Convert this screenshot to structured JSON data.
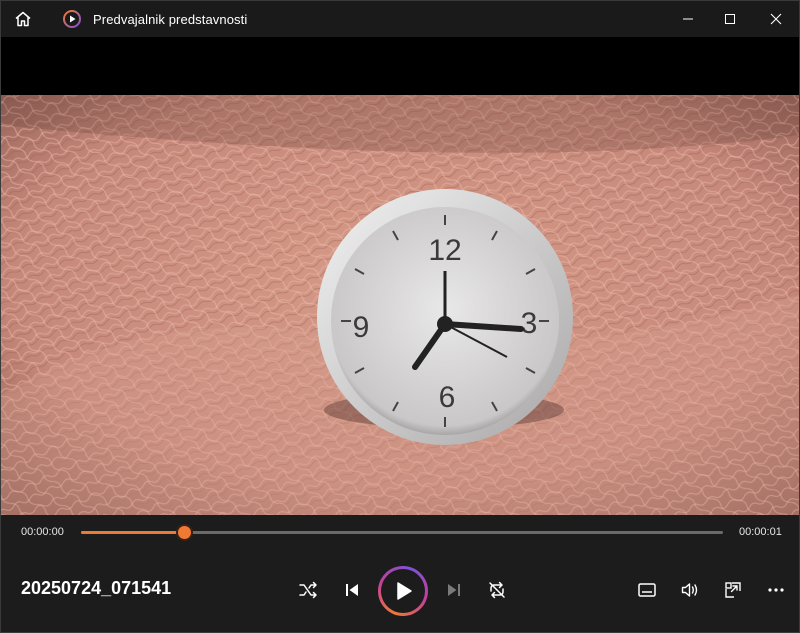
{
  "titlebar": {
    "title": "Predvajalnik predstavnosti",
    "icons": {
      "home": "home-icon",
      "app": "media-player-icon",
      "minimize": "minimize-icon",
      "maximize": "maximize-icon",
      "close": "close-icon"
    }
  },
  "video": {
    "description_icon": "video-frame",
    "clock_numerals": [
      "12",
      "3",
      "6",
      "9"
    ]
  },
  "playback": {
    "current_time": "00:00:00",
    "total_time": "00:00:01",
    "progress_fraction": 0.16
  },
  "controls": {
    "file_title": "20250724_071541",
    "icons": {
      "shuffle": "shuffle-icon",
      "previous": "previous-icon",
      "play": "play-icon",
      "next": "next-icon",
      "repeat": "repeat-off-icon",
      "captions": "captions-icon",
      "volume": "volume-icon",
      "miniplayer": "miniplayer-icon",
      "more": "more-icon"
    }
  },
  "colors": {
    "accent": "#f07a34",
    "accent_gradient_end": "#7e52d6",
    "titlebar_bg": "#1a1a1a",
    "controls_bg": "#1c1c1c"
  }
}
